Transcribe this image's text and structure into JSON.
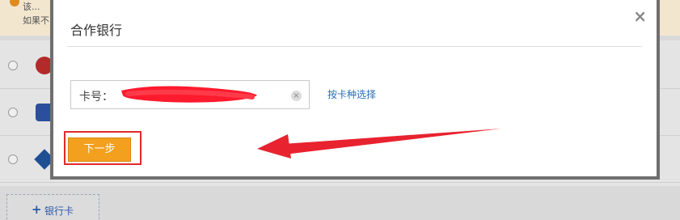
{
  "background": {
    "notice_line1": "该...",
    "notice_line2": "如果不...",
    "add_card_plus": "+",
    "add_card_label": "银行卡"
  },
  "modal": {
    "title": "合作银行",
    "close_glyph": "×",
    "card_label": "卡号：",
    "card_input_value": "",
    "clear_glyph": "×",
    "by_type_link": "按卡种选择",
    "next_button": "下一步"
  },
  "colors": {
    "accent_orange": "#f2a01e",
    "highlight_red": "#e32a2a",
    "link_blue": "#2a6db8"
  }
}
